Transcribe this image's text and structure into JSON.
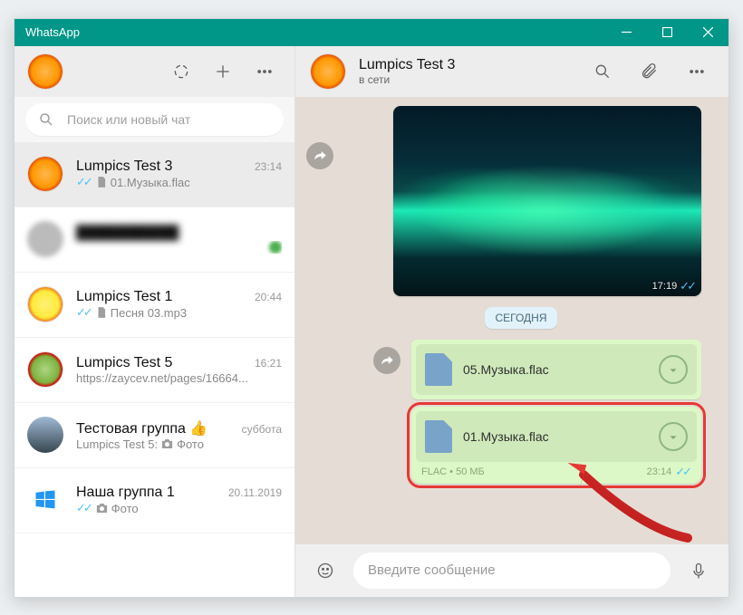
{
  "window": {
    "title": "WhatsApp"
  },
  "search": {
    "placeholder": "Поиск или новый чат"
  },
  "chats": [
    {
      "name": "Lumpics Test 3",
      "time": "23:14",
      "ticks": true,
      "doc": true,
      "sub": "01.Музыка.flac",
      "avatar": "orange",
      "active": true
    },
    {
      "name": "",
      "time": "",
      "ticks": false,
      "doc": false,
      "sub": "",
      "avatar": "blur",
      "blurred": true,
      "dot": true
    },
    {
      "name": "Lumpics Test 1",
      "time": "20:44",
      "ticks": true,
      "doc": true,
      "sub": "Песня 03.mp3",
      "avatar": "lemon"
    },
    {
      "name": "Lumpics Test 5",
      "time": "16:21",
      "ticks": false,
      "doc": false,
      "sub": "https://zaycev.net/pages/16664...",
      "avatar": "lime"
    },
    {
      "name": "Тестовая группа 👍",
      "time": "суббота",
      "ticks": false,
      "cam": true,
      "sub": "Lumpics Test 5: ",
      "sub2": "Фото",
      "avatar": "pc"
    },
    {
      "name": "Наша группа 1",
      "time": "20.11.2019",
      "ticks": true,
      "cam": true,
      "sub": "",
      "sub2": "Фото",
      "avatar": "win"
    }
  ],
  "conversation": {
    "name": "Lumpics Test 3",
    "status": "в сети",
    "image_time": "17:19",
    "date_label": "СЕГОДНЯ",
    "files": [
      {
        "name": "05.Музыка.flac",
        "meta": "",
        "time": ""
      },
      {
        "name": "01.Музыка.flac",
        "meta": "FLAC • 50 МБ",
        "time": "23:14",
        "highlight": true
      }
    ]
  },
  "compose": {
    "placeholder": "Введите сообщение"
  }
}
